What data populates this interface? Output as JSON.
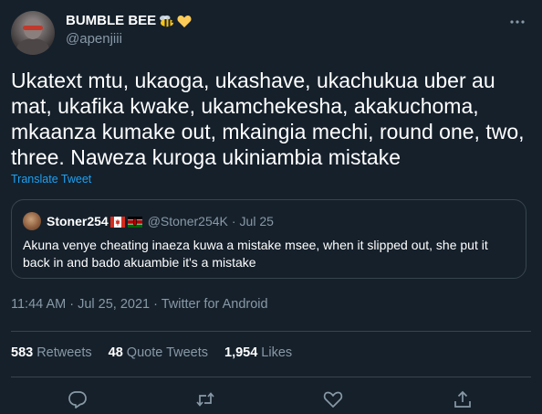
{
  "author": {
    "display_name": "BUMBLE BEE",
    "handle": "@apenjiii",
    "emoji": [
      "bee-icon",
      "yellow-heart-icon"
    ]
  },
  "tweet": {
    "text": "Ukatext mtu, ukaoga, ukashave, ukachukua uber au mat, ukafika kwake, ukamchekesha, akakuchoma, mkaanza kumake out, mkaingia mechi, round one, two, three. Naweza kuroga ukiniambia mistake",
    "translate_label": "Translate Tweet"
  },
  "quoted": {
    "name": "Stoner254",
    "flags": [
      "canada-flag-icon",
      "kenya-flag-icon"
    ],
    "handle": "@Stoner254K",
    "separator": "·",
    "date": "Jul 25",
    "text": "Akuna venye cheating inaeza kuwa a mistake msee, when it slipped out, she put it back in and bado akuambie it's a mistake"
  },
  "meta": {
    "timestamp": "11:44 AM · Jul 25, 2021 · Twitter for Android"
  },
  "stats": {
    "retweets_count": "583",
    "retweets_label": "Retweets",
    "quotes_count": "48",
    "quotes_label": "Quote Tweets",
    "likes_count": "1,954",
    "likes_label": "Likes"
  },
  "actions": [
    "reply-icon",
    "retweet-icon",
    "like-icon",
    "share-icon"
  ],
  "colors": {
    "background": "#15202b",
    "text_primary": "#ffffff",
    "text_secondary": "#8899a6",
    "link": "#1da1f2",
    "border": "#38444d"
  }
}
